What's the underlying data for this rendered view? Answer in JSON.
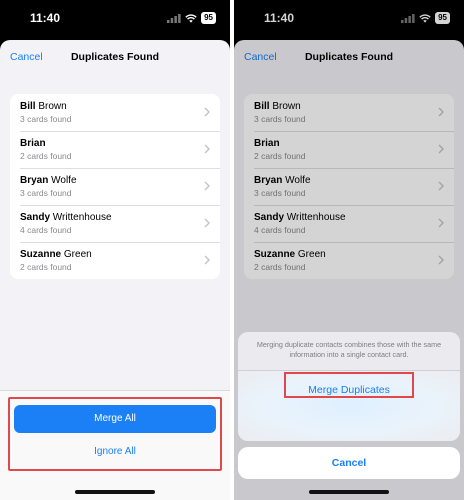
{
  "status": {
    "time": "11:40",
    "battery": "95"
  },
  "nav": {
    "cancel": "Cancel",
    "title": "Duplicates Found"
  },
  "contacts": [
    {
      "first": "Bill",
      "last": " Brown",
      "count": "3 cards found"
    },
    {
      "first": "Brian",
      "last": "",
      "count": "2 cards found"
    },
    {
      "first": "Bryan",
      "last": " Wolfe",
      "count": "3 cards found"
    },
    {
      "first": "Sandy",
      "last": " Writtenhouse",
      "count": "4 cards found"
    },
    {
      "first": "Suzanne",
      "last": " Green",
      "count": "2 cards found"
    }
  ],
  "left": {
    "merge_all": "Merge All",
    "ignore_all": "Ignore All"
  },
  "action_sheet": {
    "message": "Merging duplicate contacts combines those with the same information into a single contact card.",
    "merge": "Merge Duplicates",
    "cancel": "Cancel"
  },
  "colors": {
    "accent": "#1a7ff5",
    "highlight": "#e0484b"
  }
}
